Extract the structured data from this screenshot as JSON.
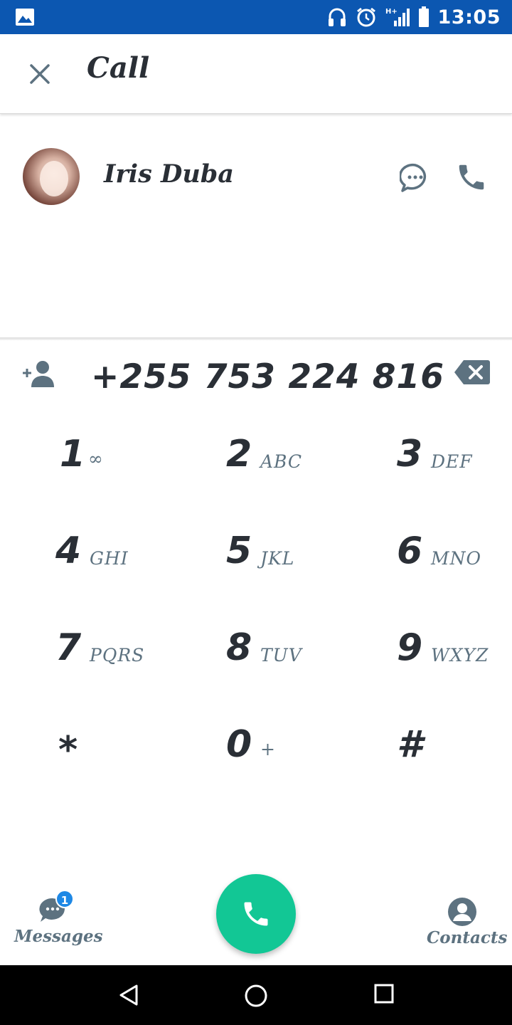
{
  "status_bar": {
    "time": "13:05",
    "icons": [
      "image-icon",
      "headset-icon",
      "alarm-icon",
      "signal-icon",
      "battery-icon"
    ],
    "color": "#0c57b1"
  },
  "header": {
    "title": "Call",
    "close_icon": "close-icon"
  },
  "contact": {
    "name": "Iris Duba",
    "message_icon": "chat-bubble-icon",
    "call_icon": "phone-icon"
  },
  "dialer": {
    "number": "+255 753 224 816",
    "add_contact_icon": "add-contact-icon",
    "backspace_icon": "backspace-icon"
  },
  "keypad": {
    "keys": [
      {
        "digit": "1",
        "letters": "∞"
      },
      {
        "digit": "2",
        "letters": "ABC"
      },
      {
        "digit": "3",
        "letters": "DEF"
      },
      {
        "digit": "4",
        "letters": "GHI"
      },
      {
        "digit": "5",
        "letters": "JKL"
      },
      {
        "digit": "6",
        "letters": "MNO"
      },
      {
        "digit": "7",
        "letters": "PQRS"
      },
      {
        "digit": "8",
        "letters": "TUV"
      },
      {
        "digit": "9",
        "letters": "WXYZ"
      },
      {
        "digit": "*",
        "letters": ""
      },
      {
        "digit": "0",
        "letters": "+"
      },
      {
        "digit": "#",
        "letters": ""
      }
    ]
  },
  "bottom_bar": {
    "messages_label": "Messages",
    "messages_badge": "1",
    "contacts_label": "Contacts",
    "call_button_color": "#12c795"
  }
}
